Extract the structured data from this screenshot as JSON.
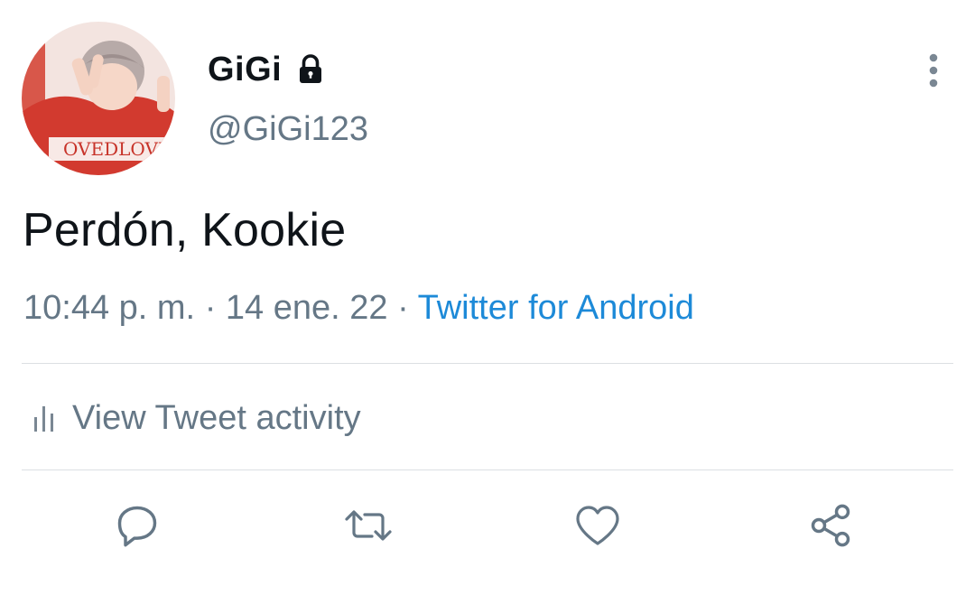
{
  "user": {
    "display_name": "GiGi",
    "handle": "@GiGi123",
    "avatar_shirt_text": "OVEDLOVE"
  },
  "tweet": {
    "text": "Perdón, Kookie",
    "time": "10:44 p. m.",
    "separator": "·",
    "date": "14 ene. 22",
    "source": "Twitter for Android"
  },
  "activity": {
    "label": "View Tweet activity"
  },
  "icons": {
    "lock": "lock-icon",
    "more": "more-vertical-icon",
    "analytics": "bar-chart-icon",
    "reply": "reply-icon",
    "retweet": "retweet-icon",
    "like": "heart-icon",
    "share": "share-icon"
  },
  "colors": {
    "text_primary": "#0f1419",
    "text_secondary": "#657786",
    "link": "#1d8ad8",
    "divider": "#dcdfe3"
  }
}
